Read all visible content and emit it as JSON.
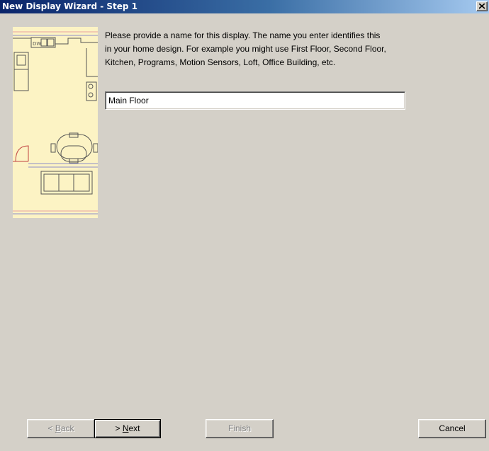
{
  "window": {
    "title": "New Display Wizard - Step 1",
    "close_glyph": "✕"
  },
  "instructions": "Please provide a name for this display.  The name you enter identifies this\nin your home design.  For example you might use First Floor, Second Floor,\nKitchen, Programs, Motion Sensors, Loft, Office Building, etc.",
  "name_field": {
    "value": "Main Floor"
  },
  "illustration": {
    "dw_label": "DW",
    "icon": "floorplan-illustration"
  },
  "buttons": {
    "back_prefix": "< ",
    "back_accel": "B",
    "back_rest": "ack",
    "next_prefix": "> ",
    "next_accel": "N",
    "next_rest": "ext",
    "finish": "Finish",
    "cancel": "Cancel"
  },
  "colors": {
    "titlebar_start": "#0a246a",
    "titlebar_end": "#a6caf0",
    "dialog_bg": "#d4d0c8",
    "illustration_bg": "#fcf3c4"
  }
}
